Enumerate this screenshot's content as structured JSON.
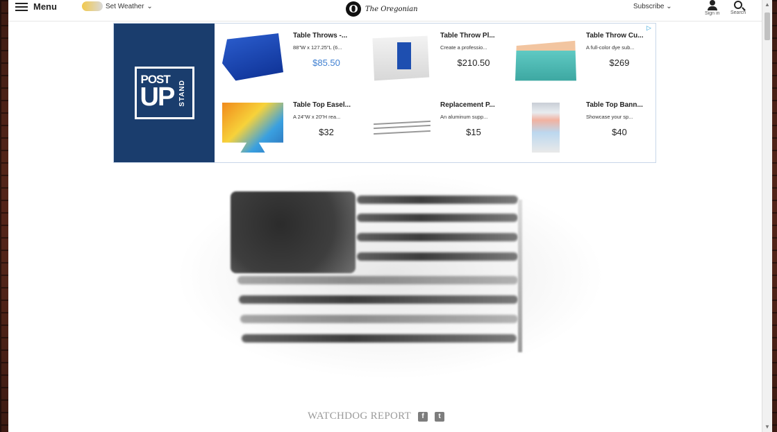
{
  "nav": {
    "menu_label": "Menu",
    "weather_label": "Set Weather ",
    "logo_mark": "O",
    "logo_text": "The Oregonian",
    "subscribe_label": "Subscribe ",
    "signin_label": "Sign in",
    "search_label": "Search"
  },
  "ad": {
    "brand_post": "POST",
    "brand_up": "UP",
    "brand_stand": "STAND",
    "products": [
      {
        "title": "Table Throws -...",
        "desc": "88\"W x 127.25\"L (6...",
        "price": "$85.50",
        "price_color": "#3f7fd1"
      },
      {
        "title": "Table Throw Pl...",
        "desc": "Create a professio...",
        "price": "$210.50"
      },
      {
        "title": "Table Throw Cu...",
        "desc": "A full-color dye sub...",
        "price": "$269"
      },
      {
        "title": "Table Top Easel...",
        "desc": "A 24\"W x 20\"H rea...",
        "price": "$32"
      },
      {
        "title": "Replacement P...",
        "desc": "An aluminum supp...",
        "price": "$15"
      },
      {
        "title": "Table Top Bann...",
        "desc": "Showcase your sp...",
        "price": "$40"
      }
    ]
  },
  "article": {
    "section_label": "WATCHDOG REPORT",
    "facebook_glyph": "f",
    "twitter_glyph": "t"
  },
  "colors": {
    "brand_navy": "#1a3d6d",
    "price_blue": "#3f7fd1",
    "brick": "#6b2f20"
  }
}
